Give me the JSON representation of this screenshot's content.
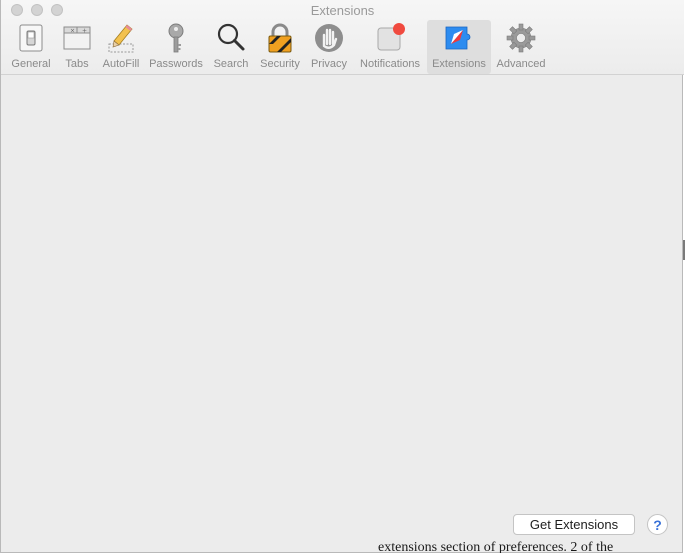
{
  "window": {
    "title": "Extensions"
  },
  "toolbar": {
    "items": [
      {
        "label": "General",
        "icon": "general-switch-icon",
        "selected": false
      },
      {
        "label": "Tabs",
        "icon": "tabs-icon",
        "selected": false
      },
      {
        "label": "AutoFill",
        "icon": "pencil-icon",
        "selected": false
      },
      {
        "label": "Passwords",
        "icon": "key-icon",
        "selected": false
      },
      {
        "label": "Search",
        "icon": "magnifier-icon",
        "selected": false
      },
      {
        "label": "Security",
        "icon": "lock-icon",
        "selected": false
      },
      {
        "label": "Privacy",
        "icon": "hand-icon",
        "selected": false
      },
      {
        "label": "Notifications",
        "icon": "notification-badge-icon",
        "selected": false
      },
      {
        "label": "Extensions",
        "icon": "compass-puzzle-icon",
        "selected": true
      },
      {
        "label": "Advanced",
        "icon": "gear-icon",
        "selected": false
      }
    ]
  },
  "footer": {
    "get_extensions_label": "Get Extensions",
    "help_label": "?"
  },
  "background_text": "extensions section of preferences. 2 of the",
  "colors": {
    "selected_bg": "#dedede",
    "notification_red": "#f04a3f",
    "extension_blue": "#2d8cf0"
  }
}
